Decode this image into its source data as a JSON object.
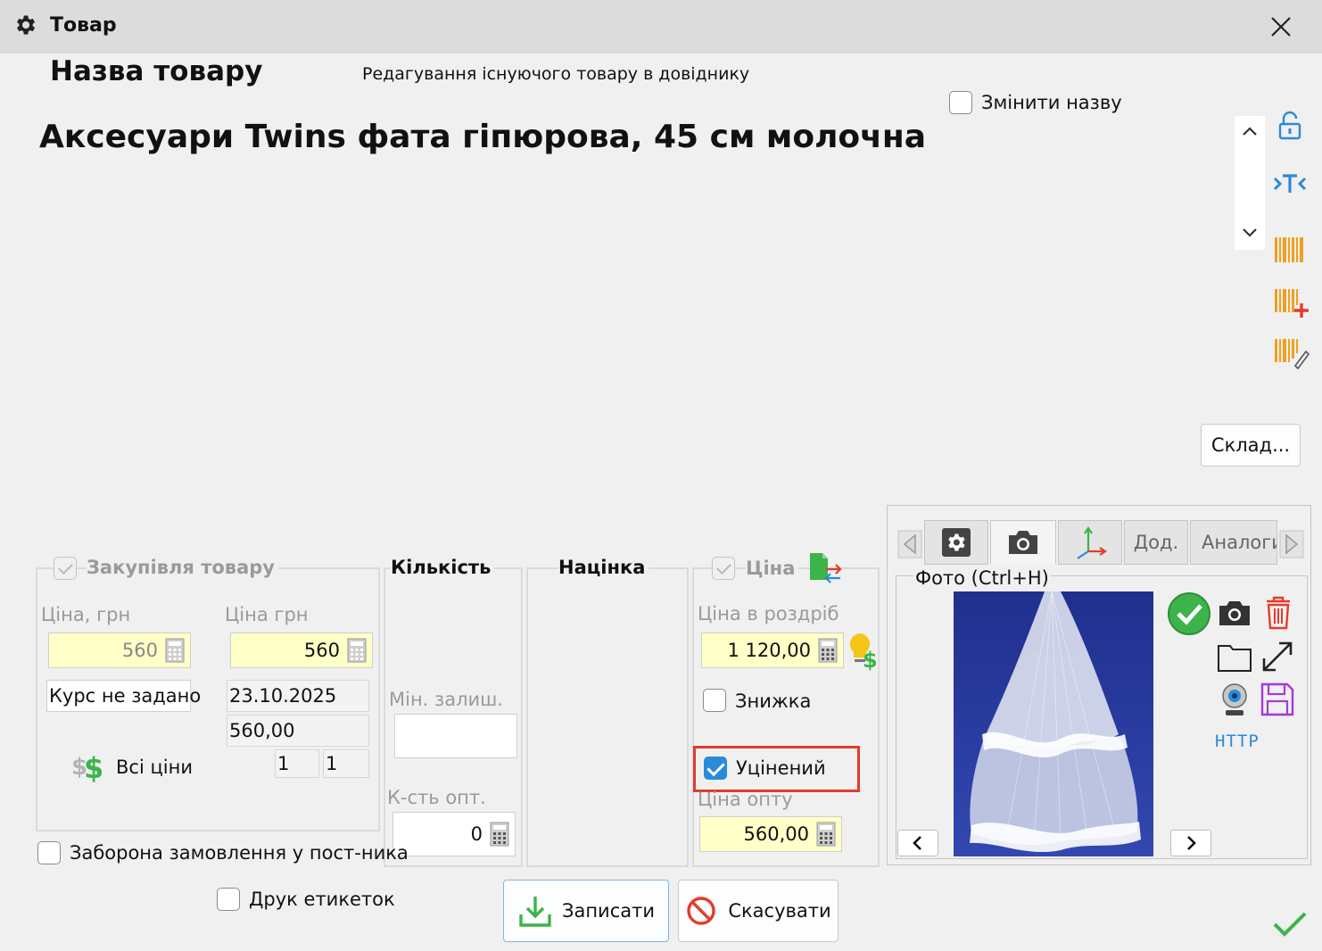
{
  "window": {
    "title": "Товар"
  },
  "header": {
    "heading": "Назва товару",
    "subtitle": "Редагування існуючого товару в довіднику",
    "rename_label": "Змінити назву",
    "product_name": "Аксесуари Twins фата гіпюрова, 45 см молочна"
  },
  "side_tools": {
    "stock_button": "Склад..."
  },
  "purchase": {
    "title": "Закупівля товару",
    "price_uah_label": "Ціна, грн",
    "price_label": "Ціна грн",
    "price_uah_value": "560",
    "price_value": "560",
    "rate_label": "Курс не задано",
    "date": "23.10.2025",
    "amount": "560,00",
    "all_prices_label": "Всі ціни",
    "count_a": "1",
    "count_b": "1"
  },
  "quantity": {
    "title": "Кількість",
    "min_stock_label": "Мін. залиш.",
    "min_stock_value": "",
    "wholesale_qty_label": "К-сть опт.",
    "wholesale_qty_value": "0"
  },
  "markup": {
    "title": "Націнка"
  },
  "price": {
    "title": "Ціна",
    "retail_label": "Ціна в роздріб",
    "retail_value": "1 120,00",
    "discount_label": "Знижка",
    "discounted_label": "Уцінений",
    "wholesale_label": "Ціна опту",
    "wholesale_value": "560,00"
  },
  "photo_panel": {
    "tabs": [
      "",
      "",
      "",
      "Дод.",
      "Аналоги"
    ],
    "photo_label": "Фото (Ctrl+H)",
    "http_label": "HTTP"
  },
  "bottom": {
    "no_order_label": "Заборона замовлення у пост-ника",
    "print_labels_label": "Друк етикеток",
    "save_button": "Записати",
    "cancel_button": "Скасувати"
  },
  "colors": {
    "accent_blue": "#2b8ad8",
    "highlight_red": "#e23c2c",
    "input_yellow": "#ffffc8",
    "barcode_orange": "#f0a020",
    "green": "#3cb44a"
  }
}
